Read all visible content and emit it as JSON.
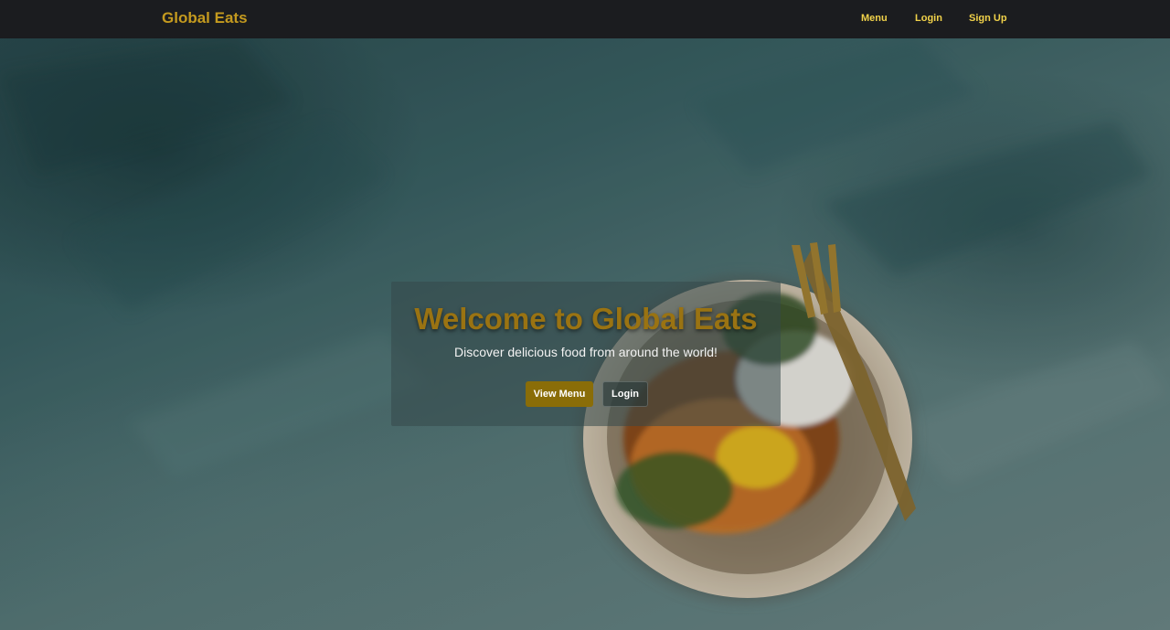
{
  "navbar": {
    "brand": "Global Eats",
    "links": [
      {
        "label": "Menu"
      },
      {
        "label": "Login"
      },
      {
        "label": "Sign Up"
      }
    ]
  },
  "hero": {
    "title": "Welcome to Global Eats",
    "subtitle": "Discover delicious food from around the world!",
    "primary_button": "View Menu",
    "secondary_button": "Login"
  },
  "colors": {
    "navbar_bg": "#1b1c1f",
    "brand": "#c49a1f",
    "nav_link": "#f1d24a",
    "primary_button": "#8a6d08",
    "hero_title": "#9a7312"
  },
  "icons": [
    "food-dish-image"
  ]
}
